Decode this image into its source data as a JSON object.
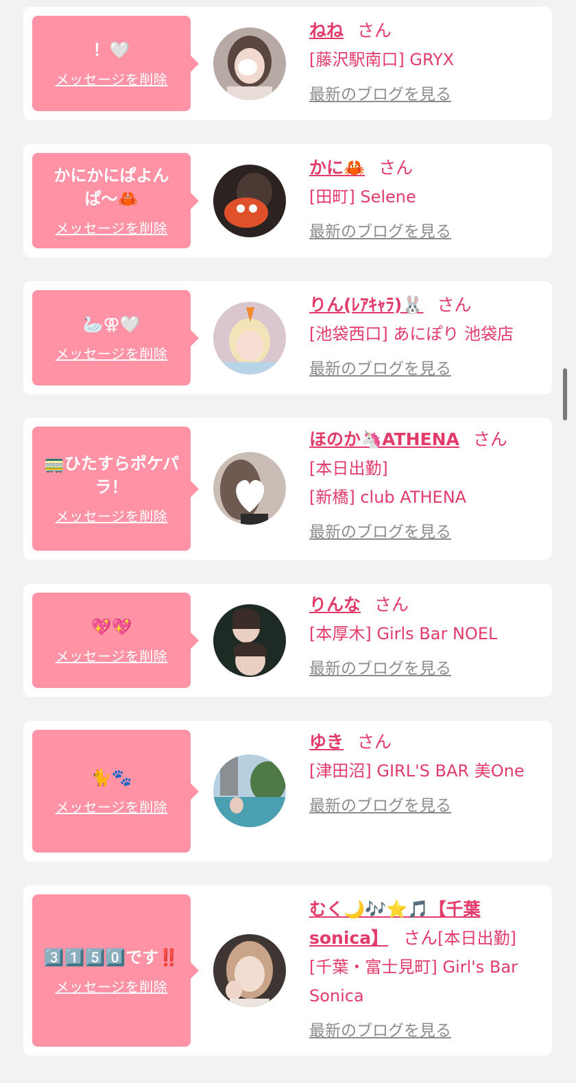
{
  "delete_label": "メッセージを削除",
  "blog_label": "最新のブログを見る",
  "san_label": "さん",
  "colors": {
    "accent": "#e23b6a",
    "bubble": "#ff93a5",
    "link_gray": "#8c8c8c",
    "background": "#f2f2f2"
  },
  "items": [
    {
      "message": "！🤍",
      "name": "ねね",
      "lines": [
        "[藤沢駅南口] GRYX"
      ]
    },
    {
      "message": "かにかにぱよんぱ〜🦀",
      "name": "かに🦀",
      "lines": [
        "[田町] Selene"
      ]
    },
    {
      "message": "🦢⚢🤍",
      "name": "りん(ﾚｱｷｬﾗ)🐰",
      "lines": [
        "[池袋西口] あにぽり 池袋店"
      ]
    },
    {
      "message": "🚃ひたすらポケパラ！",
      "name": "ほのか🦄ATHENA",
      "lines": [
        "[本日出勤]",
        "[新橋] club ATHENA"
      ]
    },
    {
      "message": "💖💖",
      "name": "りんな",
      "lines": [
        "[本厚木] Girls Bar NOEL"
      ]
    },
    {
      "message": "🐈🐾",
      "name": "ゆき",
      "lines": [
        "[津田沼] GIRL'S BAR 美One"
      ]
    },
    {
      "message": "3️⃣1️⃣5️⃣0️⃣です‼️",
      "name": "むく🌙🎶⭐️🎵【千葉sonica】",
      "lines": [
        "[本日出勤]",
        "[千葉・富士見町] Girl's Bar Sonica"
      ]
    }
  ]
}
